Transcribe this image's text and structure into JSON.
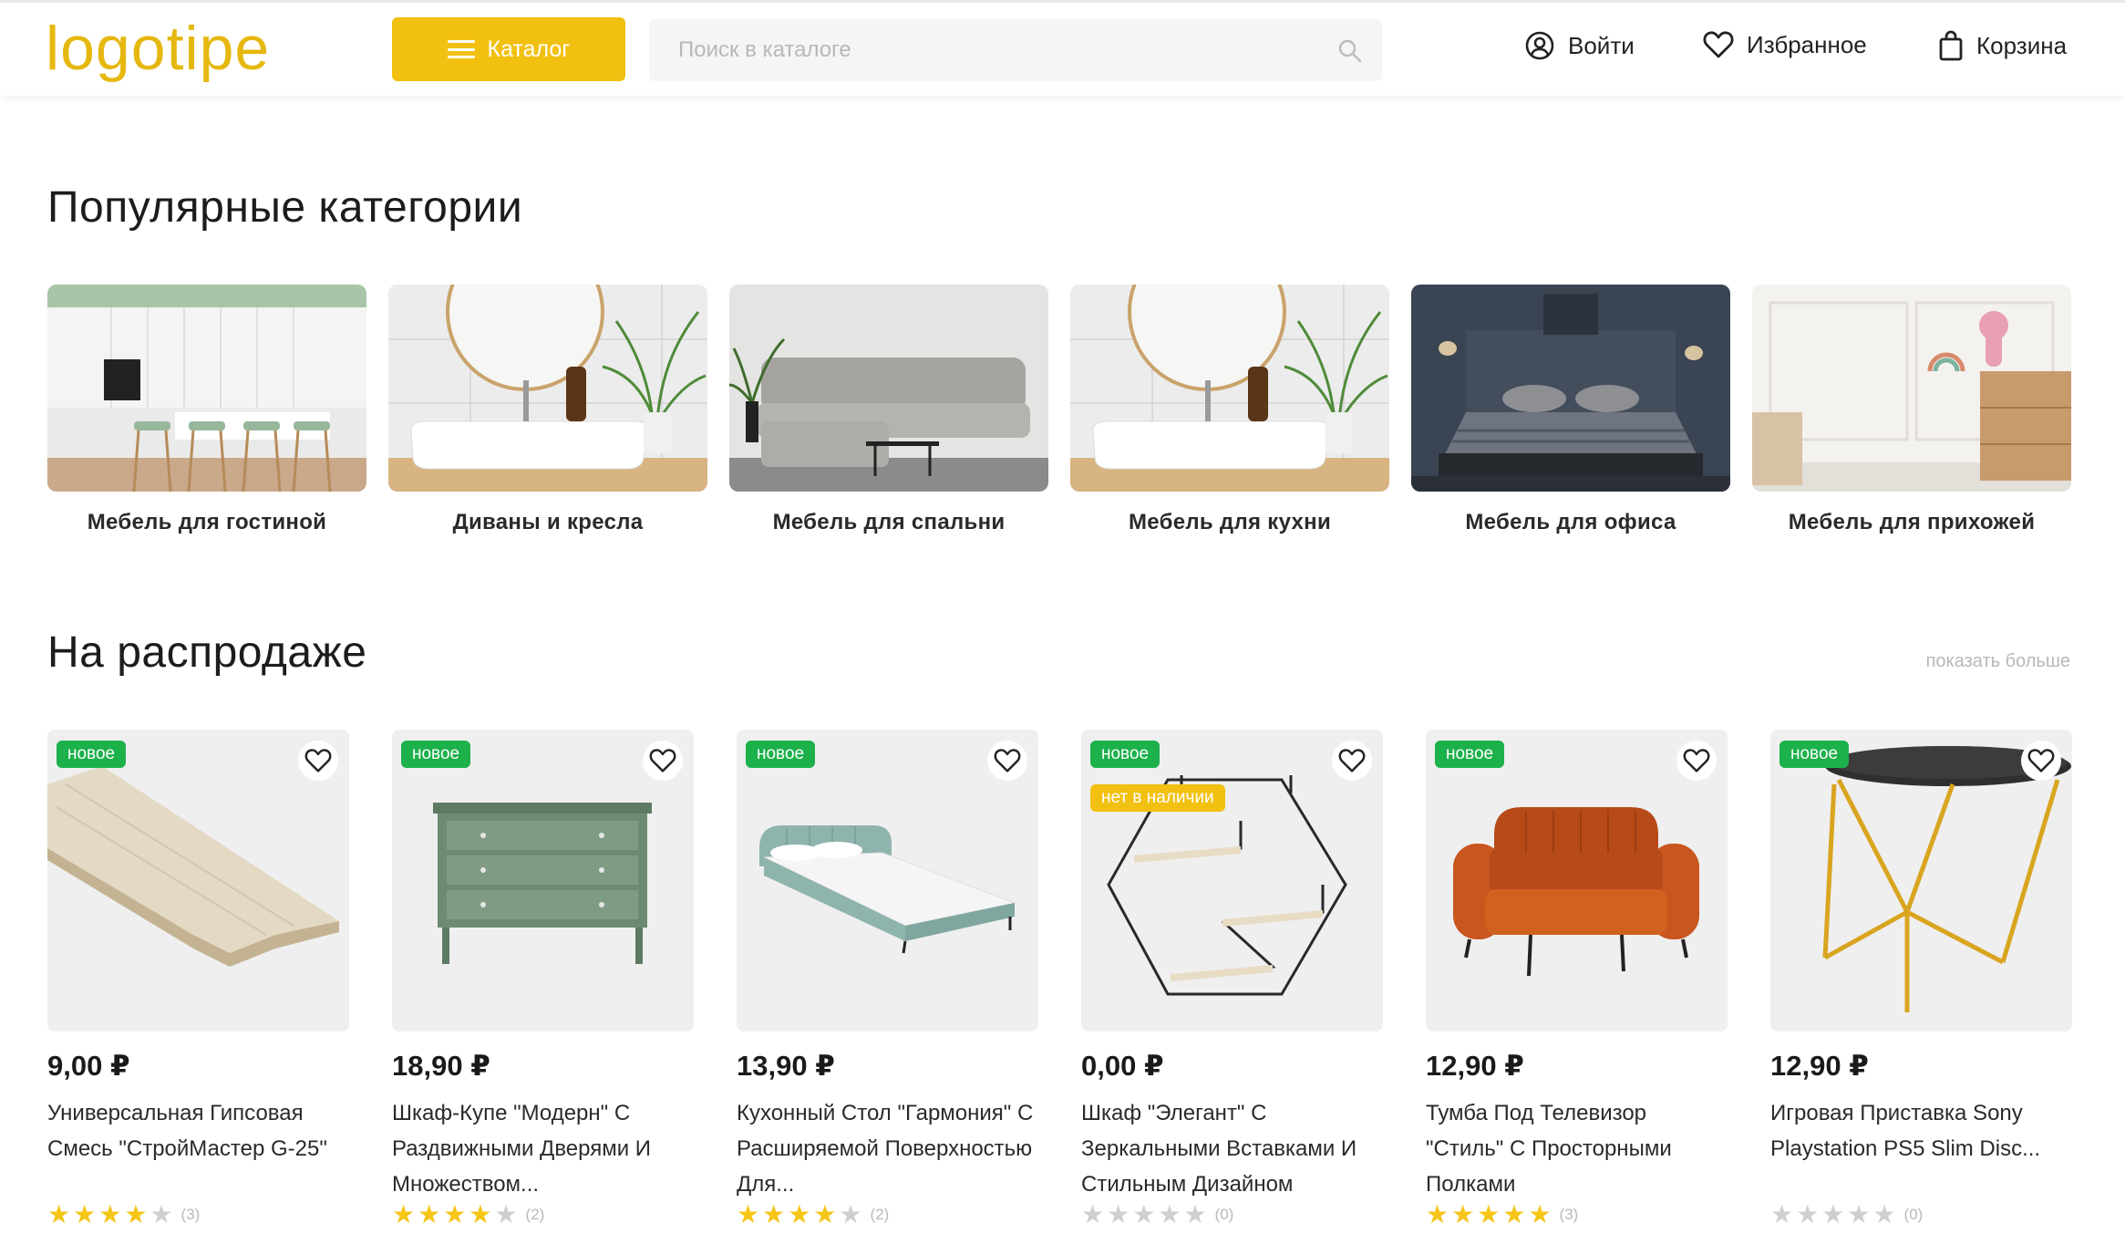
{
  "header": {
    "logo": "logotipe",
    "catalog_label": "Каталог",
    "search_placeholder": "Поиск в каталоге",
    "login_label": "Войти",
    "favorites_label": "Избранное",
    "cart_label": "Корзина"
  },
  "colors": {
    "accent": "#f2c010",
    "new_badge": "#1db14b",
    "star": "#f5c518"
  },
  "popular": {
    "title": "Популярные категории",
    "items": [
      {
        "label": "Мебель для гостиной",
        "image": "kitchen-photo"
      },
      {
        "label": "Диваны и кресла",
        "image": "bathroom-sink-photo"
      },
      {
        "label": "Мебель для спальни",
        "image": "grey-sofa-photo"
      },
      {
        "label": "Мебель для кухни",
        "image": "bathroom-sink-photo"
      },
      {
        "label": "Мебель для офиса",
        "image": "dark-bedroom-photo"
      },
      {
        "label": "Мебель для прихожей",
        "image": "white-room-photo"
      }
    ]
  },
  "sale": {
    "title": "На распродаже",
    "show_more": "показать больше",
    "products": [
      {
        "badge": "новое",
        "price": "9,00 ₽",
        "name": "Универсальная Гипсовая Смесь \"СтройМастер G-25\"",
        "stars": 4,
        "count": "(3)",
        "image": "laminate-board"
      },
      {
        "badge": "новое",
        "price": "18,90 ₽",
        "name": "Шкаф-Купе \"Модерн\" С Раздвижными Дверями И Множеством...",
        "stars": 4,
        "count": "(2)",
        "image": "green-dresser"
      },
      {
        "badge": "новое",
        "price": "13,90 ₽",
        "name": "Кухонный Стол \"Гармония\" С Расширяемой Поверхностью Для...",
        "stars": 4,
        "count": "(2)",
        "image": "bed"
      },
      {
        "badge": "новое",
        "badge2": "нет в наличии",
        "price": "0,00 ₽",
        "name": "Шкаф \"Элегант\" С Зеркальными Вставками И Стильным Дизайном",
        "stars": 0,
        "count": "(0)",
        "image": "hexagon-shelf"
      },
      {
        "badge": "новое",
        "price": "12,90 ₽",
        "name": "Тумба Под Телевизор \"Стиль\" С Просторными Полками",
        "stars": 5,
        "count": "(3)",
        "image": "orange-armchair"
      },
      {
        "badge": "новое",
        "price": "12,90 ₽",
        "name": "Игровая Приставка Sony Playstation PS5 Slim Disc...",
        "stars": 0,
        "count": "(0)",
        "image": "side-table"
      }
    ]
  }
}
